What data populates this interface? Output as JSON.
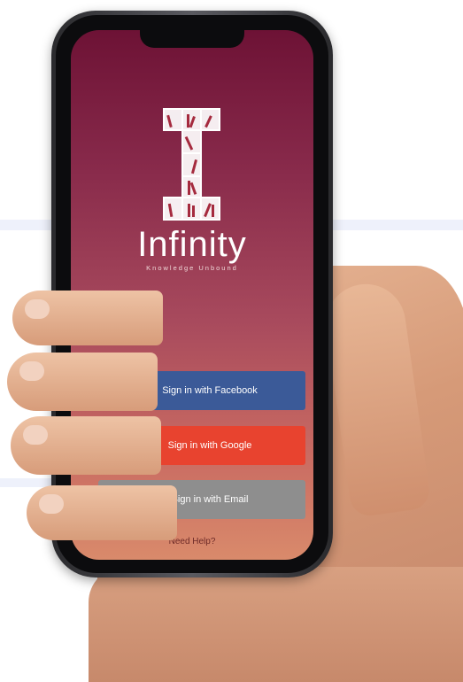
{
  "app": {
    "name": "Infinity",
    "tagline": "Knowledge Unbound"
  },
  "auth": {
    "facebook_label": "Sign in with Facebook",
    "google_label": "Sign in with Google",
    "email_label": "Sign in with Email",
    "help_label": "Need Help?"
  },
  "icons": {
    "facebook": "f",
    "google": "g+",
    "email": "paper-plane"
  },
  "colors": {
    "facebook": "#3b5a98",
    "google": "#e8432f",
    "email": "#8e8e8e",
    "screen_top": "#6d1235",
    "screen_bottom": "#d98a6b"
  }
}
